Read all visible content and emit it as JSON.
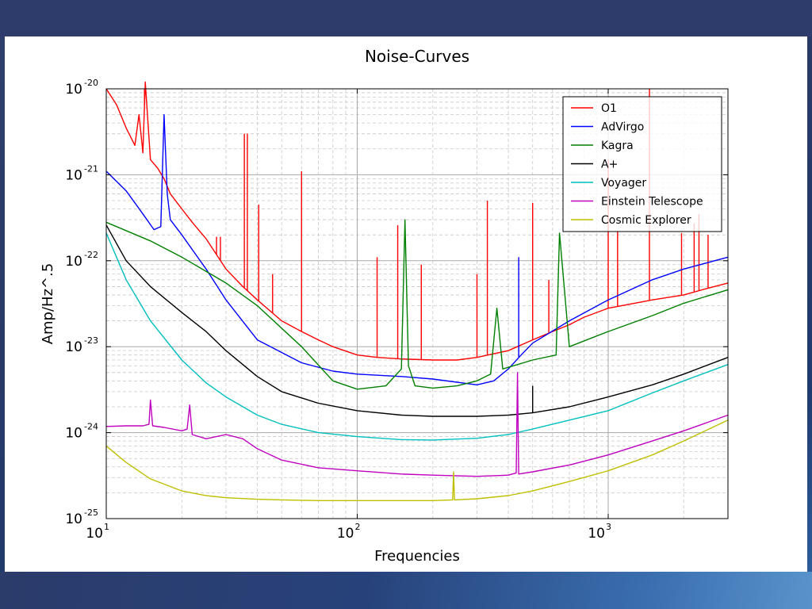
{
  "chart_data": {
    "type": "line",
    "title": "Noise-Curves",
    "xlabel": "Frequencies",
    "ylabel": "Amp/Hz^.5",
    "xscale": "log",
    "yscale": "log",
    "xlim": [
      10,
      3000
    ],
    "ylim": [
      1e-25,
      1e-20
    ],
    "grid": true,
    "legend_position": "top-right",
    "x_ticks": [
      {
        "value": 10,
        "base": "10",
        "exp": "1"
      },
      {
        "value": 100,
        "base": "10",
        "exp": "2"
      },
      {
        "value": 1000,
        "base": "10",
        "exp": "3"
      }
    ],
    "y_ticks": [
      {
        "value": 1e-25,
        "base": "10",
        "exp": "-25"
      },
      {
        "value": 1e-24,
        "base": "10",
        "exp": "-24"
      },
      {
        "value": 1e-23,
        "base": "10",
        "exp": "-23"
      },
      {
        "value": 1e-22,
        "base": "10",
        "exp": "-22"
      },
      {
        "value": 1e-21,
        "base": "10",
        "exp": "-21"
      },
      {
        "value": 1e-20,
        "base": "10",
        "exp": "-20"
      }
    ],
    "series": [
      {
        "name": "O1",
        "color": "#ff0000",
        "x": [
          10,
          11,
          12,
          13,
          13.5,
          14,
          14.3,
          15,
          16,
          17,
          18,
          20,
          22,
          25,
          30,
          35,
          40,
          50,
          60,
          70,
          80,
          100,
          120,
          150,
          200,
          250,
          300,
          400,
          500,
          600,
          700,
          800,
          1000,
          1500,
          2000,
          2500,
          3000
        ],
        "y": [
          1e-20,
          6.5e-21,
          3.5e-21,
          2.2e-21,
          5e-21,
          1.8e-21,
          1.2e-20,
          1.5e-21,
          1.2e-21,
          9e-22,
          6e-22,
          4e-22,
          2.8e-22,
          1.8e-22,
          8e-23,
          5e-23,
          3.5e-23,
          2e-23,
          1.5e-23,
          1.2e-23,
          1e-23,
          8e-24,
          7.5e-24,
          7.2e-24,
          7e-24,
          7e-24,
          7.5e-24,
          9e-24,
          1.2e-23,
          1.5e-23,
          1.8e-23,
          2.2e-23,
          2.8e-23,
          3.5e-23,
          4e-23,
          4.8e-23,
          5.5e-23
        ],
        "peaks": [
          {
            "x": 14.2,
            "y": 1e-20
          },
          {
            "x": 27.5,
            "y": 1.9e-22
          },
          {
            "x": 28.5,
            "y": 1.9e-22
          },
          {
            "x": 35.5,
            "y": 3e-21
          },
          {
            "x": 36.5,
            "y": 3e-21
          },
          {
            "x": 40.5,
            "y": 4.5e-22
          },
          {
            "x": 46,
            "y": 7e-23
          },
          {
            "x": 60,
            "y": 1.1e-21
          },
          {
            "x": 120,
            "y": 1.1e-22
          },
          {
            "x": 145,
            "y": 2.6e-22
          },
          {
            "x": 180,
            "y": 9e-23
          },
          {
            "x": 300,
            "y": 7e-23
          },
          {
            "x": 330,
            "y": 5e-22
          },
          {
            "x": 500,
            "y": 4.7e-22
          },
          {
            "x": 580,
            "y": 6e-23
          },
          {
            "x": 1000,
            "y": 1.5e-21
          },
          {
            "x": 1090,
            "y": 2.2e-22
          },
          {
            "x": 1460,
            "y": 1e-20
          },
          {
            "x": 1960,
            "y": 2.1e-22
          },
          {
            "x": 2200,
            "y": 2.7e-22
          },
          {
            "x": 2300,
            "y": 3.5e-22
          },
          {
            "x": 2500,
            "y": 2e-22
          }
        ]
      },
      {
        "name": "AdVirgo",
        "color": "#0000ff",
        "x": [
          10,
          12,
          14,
          15.5,
          16.5,
          17,
          17.5,
          18,
          20,
          25,
          30,
          40,
          60,
          80,
          100,
          150,
          200,
          300,
          350,
          400,
          450,
          500,
          700,
          1000,
          1500,
          2000,
          3000
        ],
        "y": [
          1.1e-21,
          6.5e-22,
          3.5e-22,
          2.3e-22,
          2.5e-22,
          5e-21,
          6e-22,
          3e-22,
          2e-22,
          8e-23,
          3.5e-23,
          1.2e-23,
          6.5e-24,
          5.2e-24,
          4.8e-24,
          4.5e-24,
          4.2e-24,
          3.6e-24,
          4e-24,
          5.5e-24,
          8e-24,
          1.1e-23,
          2e-23,
          3.5e-23,
          6e-23,
          8e-23,
          1.1e-22
        ],
        "peaks": [
          {
            "x": 440,
            "y": 1.1e-22
          }
        ]
      },
      {
        "name": "Kagra",
        "color": "#008000",
        "x": [
          10,
          15,
          20,
          30,
          40,
          60,
          80,
          100,
          130,
          150,
          155,
          160,
          170,
          200,
          250,
          300,
          340,
          360,
          380,
          420,
          500,
          620,
          640,
          700,
          1000,
          1500,
          2000,
          3000
        ],
        "y": [
          2.8e-22,
          1.7e-22,
          1.1e-22,
          5.5e-23,
          3e-23,
          1e-23,
          4e-24,
          3.2e-24,
          3.5e-24,
          5.5e-24,
          3e-22,
          6e-24,
          3.5e-24,
          3.3e-24,
          3.5e-24,
          4e-24,
          4.8e-24,
          2.8e-23,
          5.5e-24,
          6e-24,
          7e-24,
          8e-24,
          2.1e-22,
          1e-23,
          1.5e-23,
          2.3e-23,
          3.2e-23,
          4.6e-23
        ]
      },
      {
        "name": "A+",
        "color": "#000000",
        "x": [
          10,
          12,
          15,
          20,
          25,
          30,
          40,
          50,
          70,
          100,
          150,
          200,
          300,
          400,
          500,
          700,
          1000,
          1500,
          2000,
          3000
        ],
        "y": [
          2.6e-22,
          1e-22,
          5e-23,
          2.5e-23,
          1.5e-23,
          9e-24,
          4.5e-24,
          3e-24,
          2.2e-24,
          1.8e-24,
          1.6e-24,
          1.55e-24,
          1.55e-24,
          1.6e-24,
          1.7e-24,
          2e-24,
          2.6e-24,
          3.6e-24,
          4.8e-24,
          7.5e-24
        ],
        "peaks": [
          {
            "x": 500,
            "y": 3.5e-24
          }
        ]
      },
      {
        "name": "Voyager",
        "color": "#00bfbf",
        "x": [
          10,
          12,
          15,
          20,
          25,
          30,
          40,
          50,
          70,
          100,
          150,
          200,
          300,
          400,
          500,
          700,
          1000,
          1500,
          2000,
          3000
        ],
        "y": [
          2.1e-22,
          6e-23,
          2e-23,
          7e-24,
          3.8e-24,
          2.6e-24,
          1.6e-24,
          1.25e-24,
          1e-24,
          9e-25,
          8.3e-25,
          8.2e-25,
          8.6e-25,
          9.5e-25,
          1.1e-24,
          1.4e-24,
          1.8e-24,
          2.9e-24,
          4e-24,
          6.2e-24
        ]
      },
      {
        "name": "Einstein Telescope",
        "color": "#bf00bf",
        "x": [
          10,
          12,
          14,
          14.8,
          15,
          15.3,
          17,
          20,
          21,
          21.5,
          22,
          25,
          30,
          35,
          40,
          50,
          70,
          100,
          150,
          200,
          300,
          400,
          430,
          435,
          440,
          500,
          700,
          1000,
          1500,
          2000,
          3000
        ],
        "y": [
          1.18e-24,
          1.2e-24,
          1.2e-24,
          1.25e-24,
          2.4e-24,
          1.2e-24,
          1.15e-24,
          1.05e-24,
          1.1e-24,
          2.1e-24,
          9.5e-25,
          8.5e-25,
          9.5e-25,
          8.5e-25,
          6.5e-25,
          4.8e-25,
          3.9e-25,
          3.6e-25,
          3.3e-25,
          3.2e-25,
          3.1e-25,
          3.2e-25,
          3.4e-25,
          5e-24,
          3.3e-25,
          3.5e-25,
          4.2e-25,
          5.5e-25,
          8e-25,
          1.05e-24,
          1.6e-24
        ]
      },
      {
        "name": "Cosmic Explorer",
        "color": "#bfbf00",
        "x": [
          10,
          12,
          15,
          20,
          25,
          30,
          40,
          50,
          70,
          100,
          150,
          200,
          240,
          242,
          244,
          300,
          400,
          500,
          700,
          1000,
          1500,
          2000,
          3000
        ],
        "y": [
          7e-25,
          4.5e-25,
          2.9e-25,
          2.1e-25,
          1.85e-25,
          1.75e-25,
          1.68e-25,
          1.65e-25,
          1.62e-25,
          1.62e-25,
          1.62e-25,
          1.62e-25,
          1.65e-25,
          3.5e-25,
          1.65e-25,
          1.7e-25,
          1.85e-25,
          2.1e-25,
          2.7e-25,
          3.6e-25,
          5.5e-25,
          8e-25,
          1.4e-24
        ]
      }
    ]
  }
}
